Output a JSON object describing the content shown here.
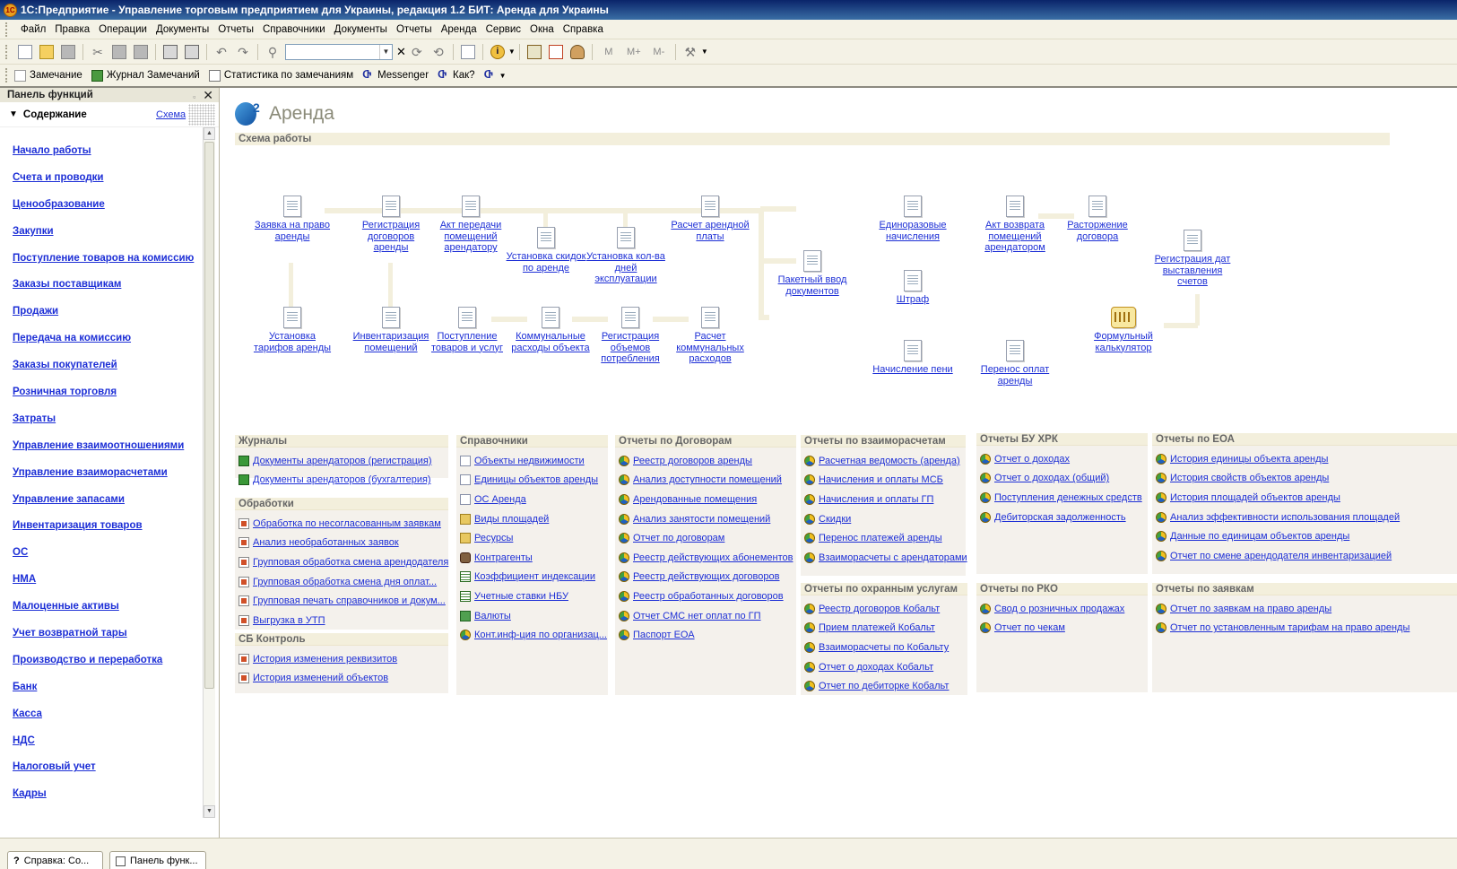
{
  "window": {
    "title": "1С:Предприятие - Управление торговым предприятием для Украины, редакция 1.2 БИТ: Аренда для Украины",
    "app_icon_label": "1С"
  },
  "menu": [
    "Файл",
    "Правка",
    "Операции",
    "Документы",
    "Отчеты",
    "Справочники",
    "Документы",
    "Отчеты",
    "Аренда",
    "Сервис",
    "Окна",
    "Справка"
  ],
  "toolbar2": {
    "items": [
      "Замечание",
      "Журнал Замечаний",
      "Статистика по замечаниям",
      "Messenger",
      "Как?"
    ]
  },
  "left_panel": {
    "header": "Панель функций",
    "section_title": "Содержание",
    "schema_link": "Схема",
    "items": [
      "Начало работы",
      "Счета и проводки",
      "Ценообразование",
      "Закупки",
      "Поступление товаров на комиссию",
      "Заказы поставщикам",
      "Продажи",
      "Передача на комиссию",
      "Заказы покупателей",
      "Розничная торговля",
      "Затраты",
      "Управление взаимоотношениями",
      "Управление взаиморасчетами",
      "Управление запасами",
      "Инвентаризация товаров",
      "ОС",
      "НМА",
      "Малоценные активы",
      "Учет возвратной тары",
      "Производство и переработка",
      "Банк",
      "Касса",
      "НДС",
      "Налоговый учет",
      "Кадры"
    ]
  },
  "main": {
    "title": "Аренда",
    "schema_header": "Схема работы",
    "diagram": {
      "n1": "Заявка на право аренды",
      "n2": "Регистрация договоров аренды",
      "n3": "Акт передачи помещений арендатору",
      "n4": "Установка скидок по аренде",
      "n5": "Установка кол-ва дней эксплуатации",
      "n6": "Расчет арендной платы",
      "n7": "Пакетный ввод документов",
      "n8": "Единоразовые начисления",
      "n9": "Штраф",
      "n10": "Начисление пени",
      "n11": "Акт возврата помещений арендатором",
      "n12": "Расторжение договора",
      "n13": "Перенос оплат аренды",
      "n14": "Регистрация дат выставления счетов",
      "n15": "Формульный калькулятор",
      "n16": "Установка тарифов аренды",
      "n17": "Инвентаризация помещений",
      "n18": "Поступление товаров и услуг",
      "n19": "Коммунальные расходы объекта",
      "n20": "Регистрация объемов потребления",
      "n21": "Расчет коммунальных расходов"
    },
    "sections": {
      "journals": {
        "title": "Журналы",
        "items": [
          "Документы арендаторов (регистрация)",
          "Документы арендаторов (бухгалтерия)"
        ]
      },
      "processing": {
        "title": "Обработки",
        "items": [
          "Обработка по несогласованным заявкам",
          "Анализ необработанных заявок",
          "Групповая обработка смена арендодателя",
          "Групповая обработка смена дня оплат...",
          "Групповая печать справочников и докум...",
          "Выгрузка в УТП"
        ]
      },
      "sb": {
        "title": "СБ Контроль",
        "items": [
          "История изменения реквизитов",
          "История изменений объектов"
        ]
      },
      "catalogs": {
        "title": "Справочники",
        "items": [
          "Объекты недвижимости",
          "Единицы объектов аренды",
          "ОС Аренда",
          "Виды площадей",
          "Ресурсы",
          "Контрагенты",
          "Коэффициент индексации",
          "Учетные ставки НБУ",
          "Валюты",
          "Конт.инф-ция по организац..."
        ]
      },
      "contracts": {
        "title": "Отчеты по Договорам",
        "items": [
          "Реестр договоров аренды",
          "Анализ доступности помещений",
          "Арендованные помещения",
          "Анализ занятости помещений",
          "Отчет по договорам",
          "Реестр действующих абонементов",
          "Реестр действующих договоров",
          "Реестр обработанных договоров",
          "Отчет СМС нет оплат по ГП",
          "Паспорт ЕОА"
        ]
      },
      "settlements": {
        "title": "Отчеты по взаиморасчетам",
        "items": [
          "Расчетная ведомость (аренда)",
          "Начисления и оплаты МСБ",
          "Начисления и оплаты ГП",
          "Скидки",
          "Перенос платежей аренды",
          "Взаиморасчеты с арендаторами"
        ]
      },
      "security": {
        "title": "Отчеты по охранным услугам",
        "items": [
          "Реестр договоров Кобальт",
          "Прием платежей Кобальт",
          "Взаиморасчеты по Кобальту",
          "Отчет о доходах Кобальт",
          "Отчет по дебиторке Кобальт"
        ]
      },
      "bu": {
        "title": "Отчеты БУ ХРК",
        "items": [
          "Отчет о доходах",
          "Отчет о доходах (общий)",
          "Поступления денежных средств",
          "Дебиторская задолженность"
        ]
      },
      "rko": {
        "title": "Отчеты по РКО",
        "items": [
          "Свод о розничных продажах",
          "Отчет по чекам"
        ]
      },
      "eoa": {
        "title": "Отчеты по ЕОА",
        "items": [
          "История единицы объекта аренды",
          "История свойств объектов аренды",
          "История площадей объектов аренды",
          "Анализ эффективности использования площадей",
          "Данные по единицам объектов аренды",
          "Отчет по смене арендодателя инвентаризацией"
        ]
      },
      "requests": {
        "title": "Отчеты по заявкам",
        "items": [
          "Отчет по заявкам на право аренды",
          "Отчет по установленным тарифам на право аренды"
        ]
      }
    }
  },
  "bottom_tabs": [
    "Справка: Со...",
    "Панель функ..."
  ]
}
